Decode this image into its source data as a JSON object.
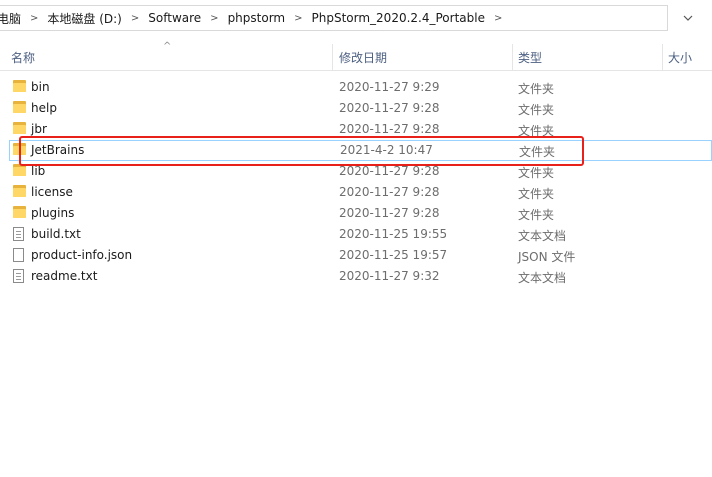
{
  "breadcrumb": [
    "电脑",
    "本地磁盘 (D:)",
    "Software",
    "phpstorm",
    "PhpStorm_2020.2.4_Portable"
  ],
  "columns": {
    "name": "名称",
    "date": "修改日期",
    "type": "类型",
    "size": "大小"
  },
  "files": [
    {
      "name": "bin",
      "date": "2020-11-27 9:29",
      "type": "文件夹",
      "icon": "folder"
    },
    {
      "name": "help",
      "date": "2020-11-27 9:28",
      "type": "文件夹",
      "icon": "folder"
    },
    {
      "name": "jbr",
      "date": "2020-11-27 9:28",
      "type": "文件夹",
      "icon": "folder"
    },
    {
      "name": "JetBrains",
      "date": "2021-4-2 10:47",
      "type": "文件夹",
      "icon": "folder"
    },
    {
      "name": "lib",
      "date": "2020-11-27 9:28",
      "type": "文件夹",
      "icon": "folder"
    },
    {
      "name": "license",
      "date": "2020-11-27 9:28",
      "type": "文件夹",
      "icon": "folder"
    },
    {
      "name": "plugins",
      "date": "2020-11-27 9:28",
      "type": "文件夹",
      "icon": "folder"
    },
    {
      "name": "build.txt",
      "date": "2020-11-25 19:55",
      "type": "文本文档",
      "icon": "text-file"
    },
    {
      "name": "product-info.json",
      "date": "2020-11-25 19:57",
      "type": "JSON 文件",
      "icon": "file"
    },
    {
      "name": "readme.txt",
      "date": "2020-11-27 9:32",
      "type": "文本文档",
      "icon": "text-file"
    }
  ],
  "colors": {
    "header_text": "#4d6082",
    "highlight_box": "#e8221b",
    "hover_border": "#99d1ff",
    "folder": "#ffd766"
  }
}
